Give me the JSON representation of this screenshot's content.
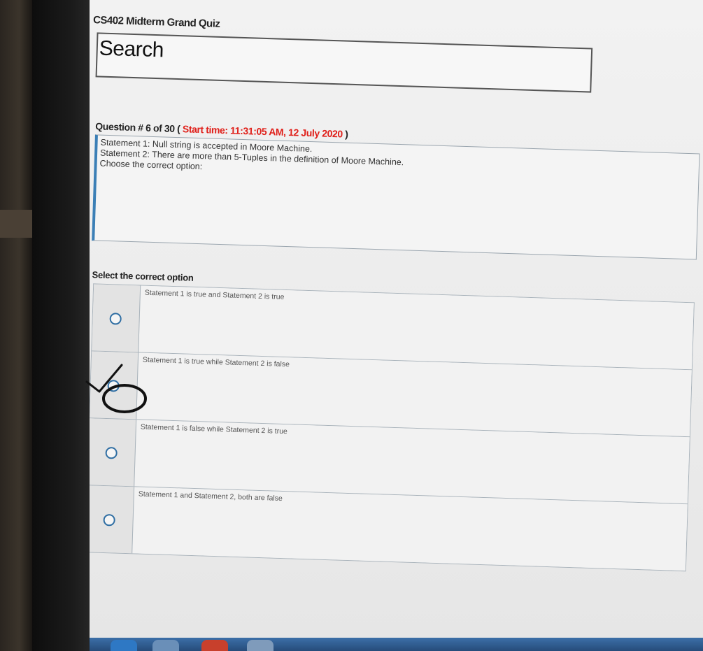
{
  "quiz": {
    "title": "CS402 Midterm Grand Quiz"
  },
  "search": {
    "label": "Search"
  },
  "question": {
    "number_text": "Question # 6 of 30 ( ",
    "start_time_text": "Start time: 11:31:05 AM, 12 July 2020",
    "close_paren": " )",
    "lines": [
      "Statement 1: Null string is accepted in Moore Machine.",
      "Statement 2: There are more than 5-Tuples in the definition of Moore Machine.",
      "Choose the correct option:"
    ]
  },
  "options": {
    "label": "Select the correct option",
    "items": [
      {
        "text": "Statement 1 is true and Statement 2 is true",
        "marked": false
      },
      {
        "text": "Statement 1 is true while Statement 2 is false",
        "marked": true
      },
      {
        "text": "Statement 1 is false while Statement 2 is true",
        "marked": false
      },
      {
        "text": "Statement 1 and Statement 2, both are false",
        "marked": false
      }
    ]
  },
  "colors": {
    "start_time": "#e0201a",
    "radio": "#2f6ea3",
    "question_accent": "#3b7fb6",
    "taskbar": "#264c7a"
  }
}
